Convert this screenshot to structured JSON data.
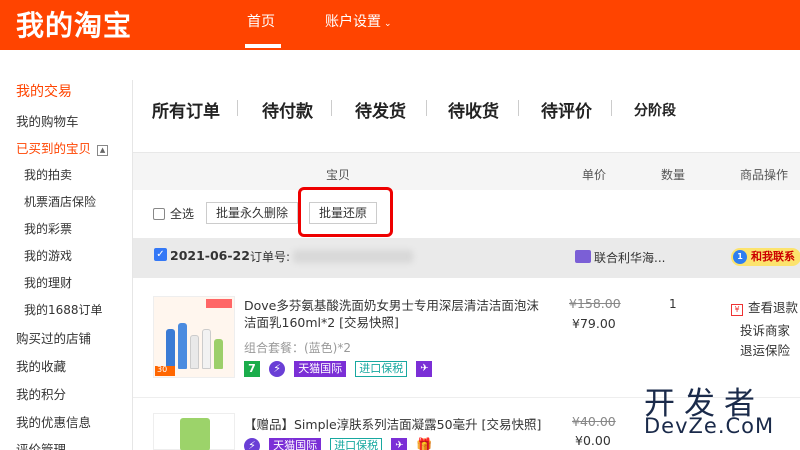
{
  "header": {
    "logo": "我的淘宝",
    "nav_home": "首页",
    "nav_account": "账户设置",
    "brand_color": "#ff4400"
  },
  "sidebar": {
    "my_trades": "我的交易",
    "cart": "我的购物车",
    "bought": "已买到的宝贝",
    "collapse_glyph": "▲",
    "bought_children": [
      "我的拍卖",
      "机票酒店保险",
      "我的彩票",
      "我的游戏",
      "我的理财",
      "我的1688订单"
    ],
    "others": [
      "购买过的店铺",
      "我的收藏",
      "我的积分",
      "我的优惠信息",
      "评价管理"
    ]
  },
  "tabs": [
    "所有订单",
    "待付款",
    "待发货",
    "待收货",
    "待评价",
    "分阶段"
  ],
  "table_header": {
    "item": "宝贝",
    "unit_price": "单价",
    "quantity": "数量",
    "actions": "商品操作"
  },
  "bulk": {
    "select_all": "全选",
    "delete_forever": "批量永久删除",
    "restore": "批量还原"
  },
  "order": {
    "date": "2021-06-22",
    "order_no_label": "订单号:",
    "store": "联合利华海...",
    "chat_icon": "1",
    "chat_label": "和我联系",
    "items": [
      {
        "title": "Dove多芬氨基酸洗面奶女男士专用深层清洁洁面泡沫洁面乳160ml*2 [交易快照]",
        "sku": "组合套餐：(蓝色)*2",
        "badges": [
          "7",
          "⚡",
          "天猫国际",
          "进口保税",
          "✈"
        ],
        "original_price": "¥158.00",
        "price": "¥79.00",
        "quantity": "1",
        "actions": [
          "查看退款",
          "投诉商家",
          "退运保险"
        ],
        "thumb_badge": "30"
      },
      {
        "title": "【赠品】Simple淳肤系列洁面凝露50毫升 [交易快照]",
        "badges": [
          "⚡",
          "天猫国际",
          "进口保税",
          "✈",
          "🎁"
        ],
        "original_price": "¥40.00",
        "price": "¥0.00"
      }
    ]
  },
  "watermark": {
    "line1": "开发者",
    "line2": "DevZe.CoM"
  }
}
